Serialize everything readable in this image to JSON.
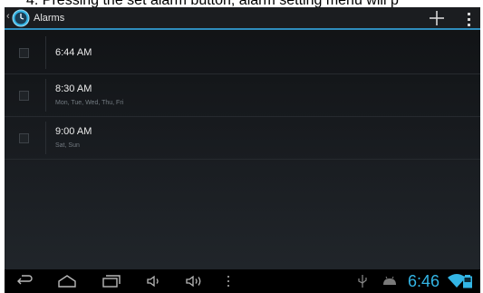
{
  "caption": "4. Pressing the set alarm button, alarm setting menu will p",
  "action_bar": {
    "title": "Alarms",
    "add_icon": "plus-icon",
    "overflow_icon": "overflow-menu-icon",
    "app_icon": "clock-icon"
  },
  "alarms": [
    {
      "time": "6:44 AM",
      "days": "",
      "enabled": false
    },
    {
      "time": "8:30 AM",
      "days": "Mon, Tue, Wed, Thu, Fri",
      "enabled": false
    },
    {
      "time": "9:00 AM",
      "days": "Sat, Sun",
      "enabled": false
    }
  ],
  "nav_bar": {
    "clock": "6:46",
    "accent_color": "#33b5e5"
  },
  "colors": {
    "accent": "#33b5e5"
  }
}
